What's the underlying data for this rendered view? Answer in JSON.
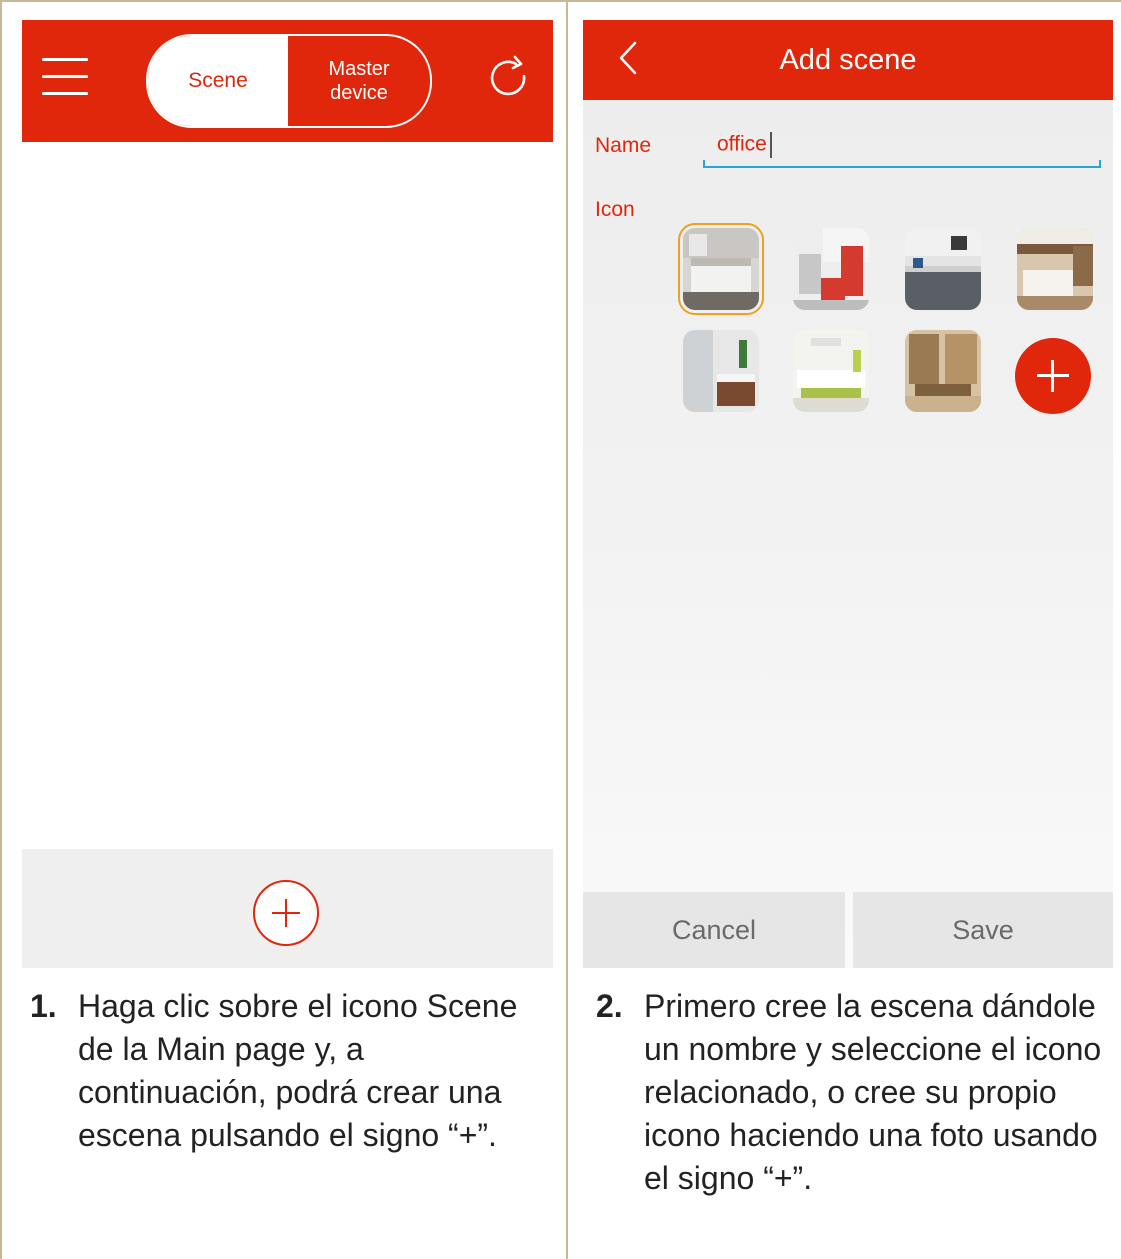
{
  "left_screen": {
    "segment": {
      "scene_label": "Scene",
      "master_line1": "Master",
      "master_line2": "device"
    },
    "icons": {
      "menu": "hamburger-menu-icon",
      "refresh": "refresh-icon",
      "add": "add-circle-icon"
    }
  },
  "right_screen": {
    "title": "Add scene",
    "name_label": "Name",
    "name_value": "office",
    "icon_label": "Icon",
    "cancel_label": "Cancel",
    "save_label": "Save",
    "thumbnails": [
      "bedroom",
      "kids-room",
      "kitchen",
      "bedroom-wood",
      "bathroom",
      "living-room",
      "study"
    ]
  },
  "captions": {
    "left_number": "1.",
    "left_text": "Haga clic sobre el icono Scene de la Main page y, a continuación, podrá crear una escena pulsando el signo “+”.",
    "right_number": "2.",
    "right_text": "Primero cree la escena dándole un nombre y seleccione el icono relacionado, o cree su propio icono haciendo una foto usando el signo “+”."
  },
  "colors": {
    "brand_red": "#e0270b",
    "input_underline": "#2aa3d6",
    "selected_outline": "#f0a020"
  }
}
